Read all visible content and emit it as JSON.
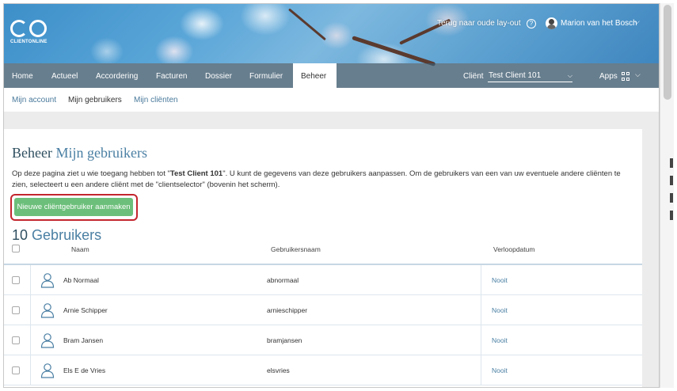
{
  "brand": {
    "logo_letters": "CO",
    "logo_text": "CLIENTONLINE"
  },
  "header": {
    "old_layout_link": "Terug naar oude lay-out",
    "help_icon": "?",
    "user_name": "Marion van het Bosch",
    "user_chevron": "⌵"
  },
  "nav": {
    "items": [
      {
        "label": "Home"
      },
      {
        "label": "Actueel"
      },
      {
        "label": "Accordering"
      },
      {
        "label": "Facturen"
      },
      {
        "label": "Dossier"
      },
      {
        "label": "Formulier"
      },
      {
        "label": "Beheer",
        "active": true
      }
    ],
    "client_label": "Cliënt",
    "client_value": "Test Client 101",
    "client_caret": "⌵",
    "apps_label": "Apps",
    "apps_chevron": "⌵"
  },
  "subnav": {
    "items": [
      {
        "label": "Mijn account"
      },
      {
        "label": "Mijn gebruikers",
        "current": true
      },
      {
        "label": "Mijn cliënten"
      }
    ]
  },
  "page": {
    "title_prefix": "Beheer",
    "title_accent": "Mijn gebruikers",
    "intro_part1": "Op deze pagina ziet u wie toegang hebben tot \"",
    "intro_bold": "Test Client 101",
    "intro_part2": "\". U kunt de gegevens van deze gebruikers aanpassen. Om de gebruikers van een van uw eventuele andere cliënten te zien, selecteert u een andere cliënt met de \"clientselector\" (bovenin het scherm).",
    "new_button": "Nieuwe cliëntgebruiker aanmaken",
    "count_number": "10",
    "count_label": "Gebruikers"
  },
  "table": {
    "columns": {
      "name": "Naam",
      "username": "Gebruikersnaam",
      "expiry": "Verloopdatum"
    },
    "rows": [
      {
        "name": "Ab Normaal",
        "username": "abnormaal",
        "expiry": "Nooit"
      },
      {
        "name": "Arnie Schipper",
        "username": "arnieschipper",
        "expiry": "Nooit"
      },
      {
        "name": "Bram Jansen",
        "username": "bramjansen",
        "expiry": "Nooit"
      },
      {
        "name": "Els E de Vries",
        "username": "elsvries",
        "expiry": "Nooit"
      }
    ]
  },
  "colors": {
    "accent": "#4a7fa3",
    "nav_bg": "#3c5a6e",
    "button_green": "#6cbf7a",
    "highlight_red": "#c4262e"
  }
}
